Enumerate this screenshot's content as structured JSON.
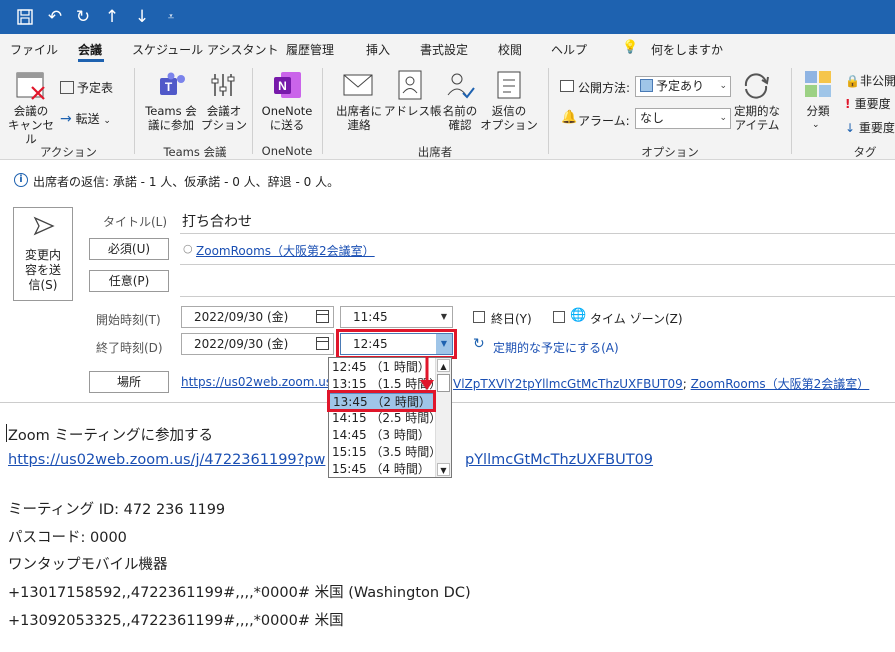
{
  "qat": {
    "icons": [
      "save-icon",
      "undo-icon",
      "redo-icon",
      "up-icon",
      "down-icon",
      "customize-icon"
    ]
  },
  "menu": [
    "ファイル",
    "会議",
    "スケジュール アシスタント",
    "履歴管理",
    "挿入",
    "書式設定",
    "校閲",
    "ヘルプ",
    "何をしますか"
  ],
  "ribbon": {
    "cancel_meeting": "会議の\nキャンセル",
    "calendar": "予定表",
    "forward": "転送",
    "teams_join": "Teams 会\n議に参加",
    "meeting_options": "会議オ\nプション",
    "onenote": "OneNote\nに送る",
    "contact_attendees": "出席者に\n連絡",
    "address_book": "アドレス帳",
    "check_names": "名前の\n確認",
    "response_options": "返信の\nオプション",
    "show_as_label": "公開方法:",
    "show_as_value": "予定あり",
    "reminder_label": "アラーム:",
    "reminder_value": "なし",
    "recurrence": "定期的な\nアイテム",
    "categorize": "分類",
    "private": "非公開",
    "high_importance": "重要度",
    "low_importance": "重要度",
    "groups": [
      "アクション",
      "Teams 会議",
      "OneNote",
      "出席者",
      "オプション",
      "タグ"
    ]
  },
  "info": "出席者の返信: 承諾 - 1 人、仮承諾 - 0 人、辞退 - 0 人。",
  "form": {
    "send_update": "変更内\n容を送\n信(S)",
    "title_label": "タイトル(L)",
    "title_value": "打ち合わせ",
    "required_label": "必須(U)",
    "required_value": "ZoomRooms（大阪第2会議室）",
    "optional_label": "任意(P)",
    "start_label": "開始時刻(T)",
    "start_date": "2022/09/30 (金)",
    "start_time": "11:45",
    "all_day": "終日(Y)",
    "time_zone": "タイム ゾーン(Z)",
    "end_label": "終了時刻(D)",
    "end_date": "2022/09/30 (金)",
    "end_time": "12:45",
    "make_recurring": "定期的な予定にする(A)",
    "location_label": "場所",
    "location_value_a": "https://us02web.zoom.us/",
    "location_value_b": "VlZpTXVlY2tpYllmcGtMcThzUXFBUT09",
    "location_value_c": "ZoomRooms（大阪第2会議室）"
  },
  "dropdown": {
    "options": [
      "12:45 （1 時間）",
      "13:15 （1.5 時間）",
      "13:45 （2 時間）",
      "14:15 （2.5 時間）",
      "14:45 （3 時間）",
      "15:15 （3.5 時間）",
      "15:45 （4 時間）"
    ],
    "selected": "13:45 （2 時間）"
  },
  "body": {
    "line1": "Zoom ミーティングに参加する",
    "link_a": "https://us02web.zoom.us/j/4722361199?pw",
    "link_b": "pYllmcGtMcThzUXFBUT09",
    "meeting_id": "ミーティング ID: 472 236 1199",
    "passcode": "パスコード: 0000",
    "one_tap": "ワンタップモバイル機器",
    "phone1": "+13017158592,,4722361199#,,,,*0000# 米国 (Washington DC)",
    "phone2": "+13092053325,,4722361199#,,,,*0000# 米国"
  },
  "colors": {
    "titlebar": "#1e62b0",
    "highlight": "#e0162b",
    "selection": "#9fc5e8",
    "link": "#1a4fb3"
  }
}
